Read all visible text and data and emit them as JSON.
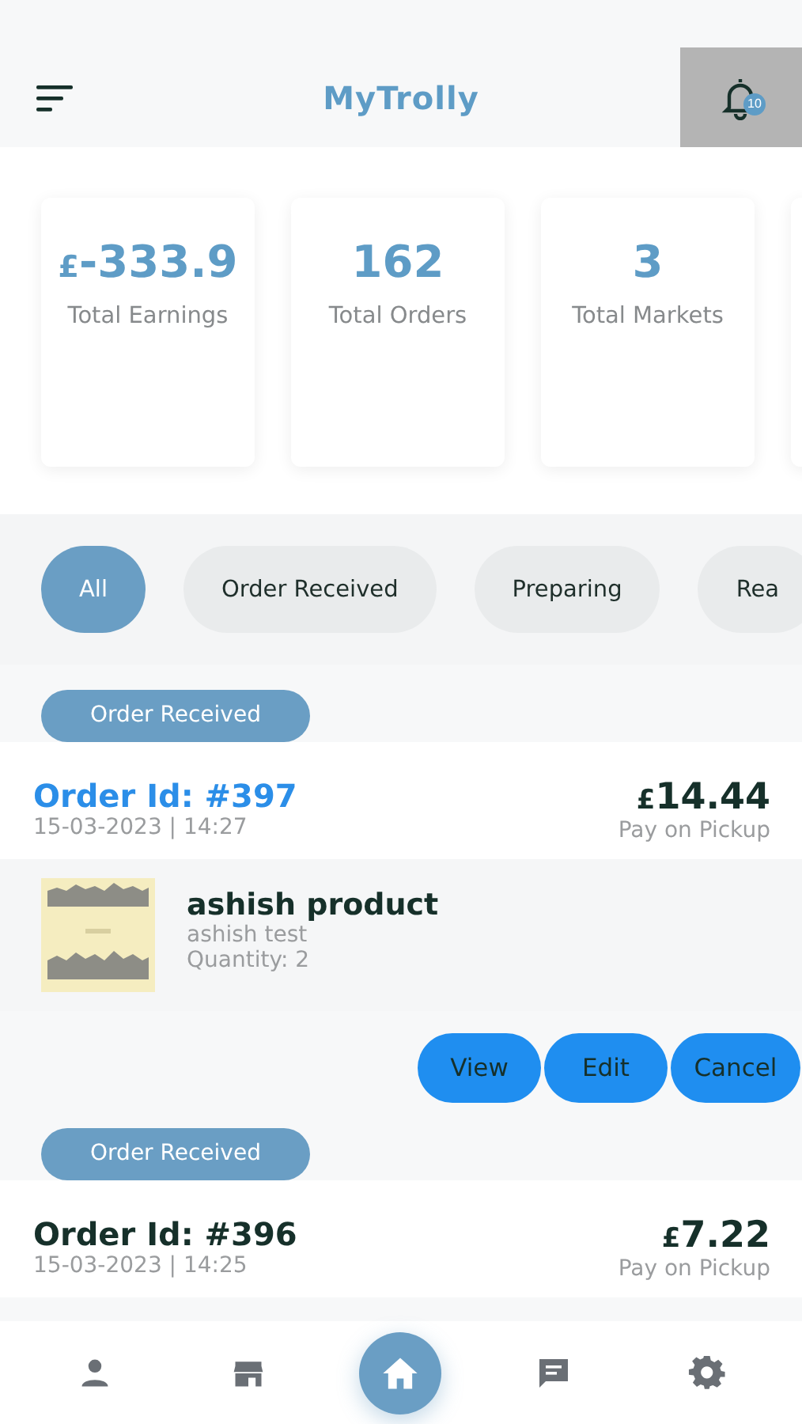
{
  "header": {
    "title": "MyTrolly",
    "notification_count": "10"
  },
  "stats": [
    {
      "currency": "£",
      "value": "-333.9",
      "label": "Total Earnings"
    },
    {
      "value": "162",
      "label": "Total Orders"
    },
    {
      "value": "3",
      "label": "Total Markets"
    }
  ],
  "filters": [
    {
      "label": "All",
      "selected": true
    },
    {
      "label": "Order Received",
      "selected": false
    },
    {
      "label": "Preparing",
      "selected": false
    },
    {
      "label": "Rea",
      "selected": false
    }
  ],
  "orders": [
    {
      "status": "Order Received",
      "order_id": "Order Id: #397",
      "date": "15-03-2023 | 14:27",
      "currency": "£",
      "amount": "14.44",
      "payment": "Pay on Pickup",
      "selected": true,
      "items": [
        {
          "name": "ashish product",
          "description": "ashish test",
          "quantity": "Quantity: 2"
        }
      ],
      "actions": [
        "View",
        "Edit",
        "Cancel"
      ]
    },
    {
      "status": "Order Received",
      "order_id": "Order Id: #396",
      "date": "15-03-2023 | 14:25",
      "currency": "£",
      "amount": "7.22",
      "payment": "Pay on Pickup",
      "selected": false
    }
  ],
  "nav": [
    {
      "selected": false
    },
    {
      "selected": false
    },
    {
      "selected": true
    },
    {
      "selected": false
    },
    {
      "selected": false
    }
  ]
}
